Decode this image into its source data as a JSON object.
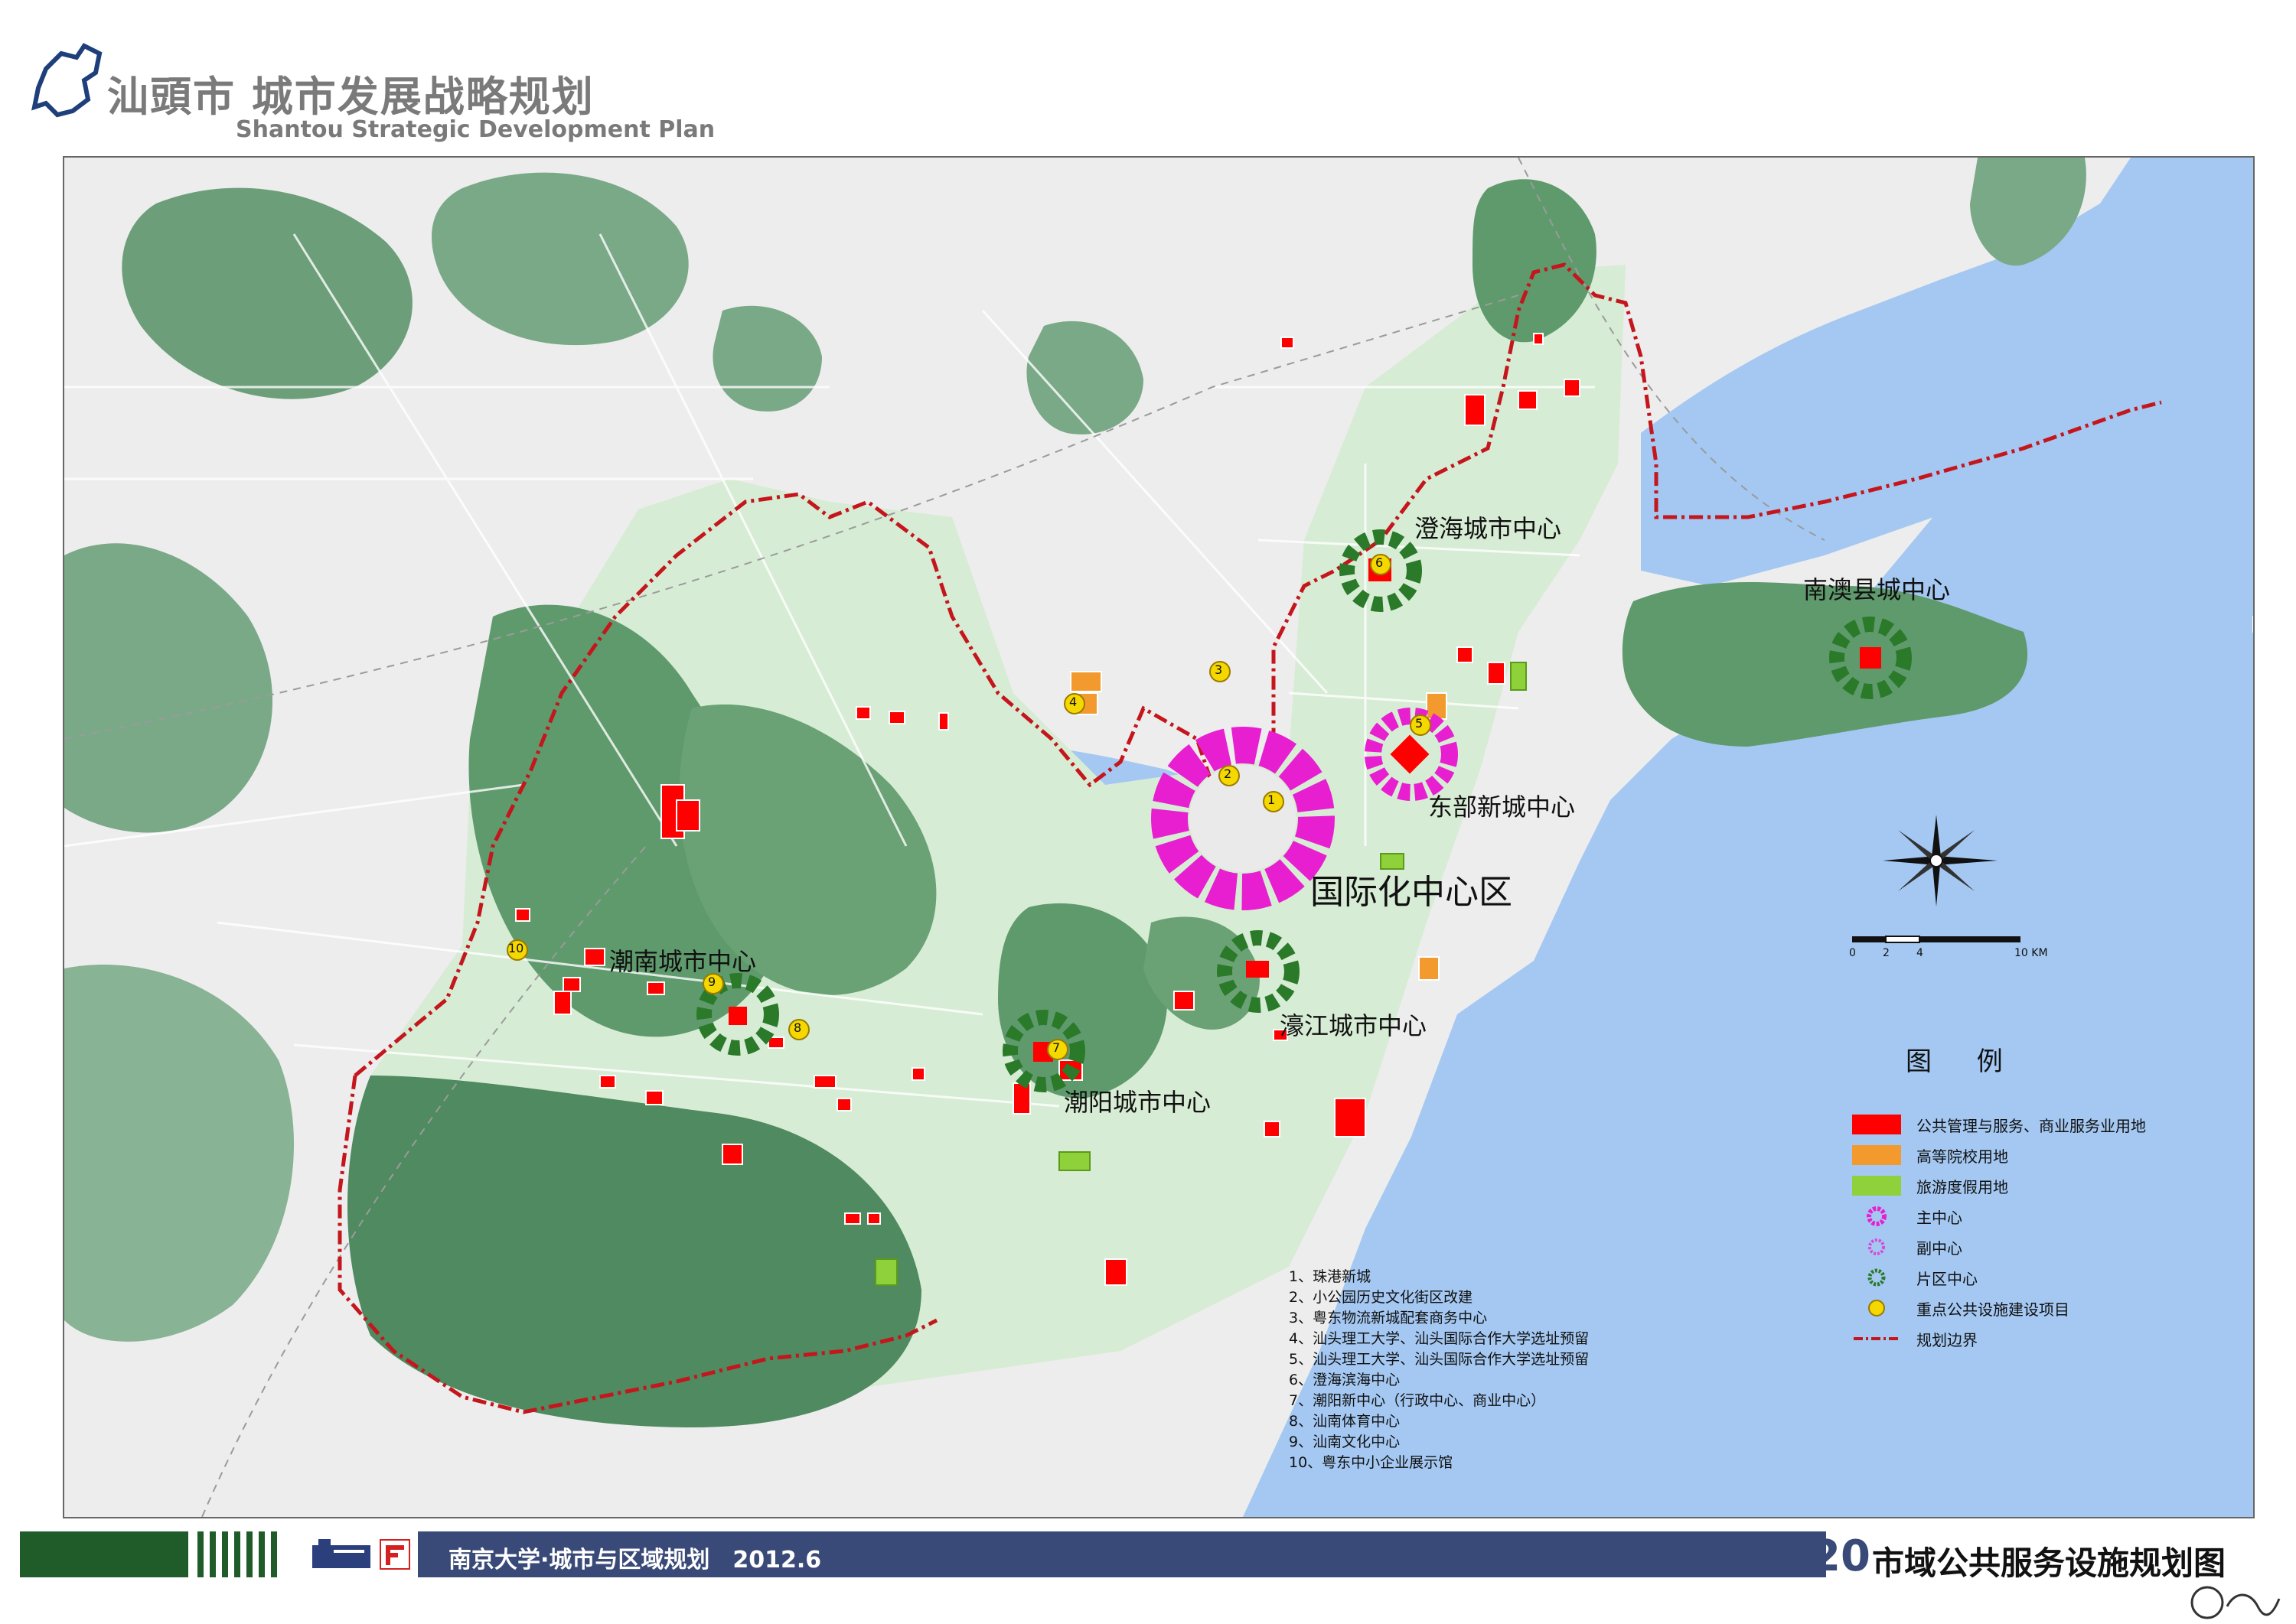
{
  "header": {
    "title_cn": "汕頭市 城市发展战略规划",
    "title_en": "Shantou Strategic Development Plan"
  },
  "map": {
    "center_labels": {
      "chenghai": "澄海城市中心",
      "nanao": "南澳县城中心",
      "dongbu": "东部新城中心",
      "intl": "国际化中心区",
      "haojiang": "濠江城市中心",
      "chaonan": "潮南城市中心",
      "chaoyang": "潮阳城市中心"
    },
    "markers": [
      "1",
      "2",
      "3",
      "4",
      "5",
      "6",
      "7",
      "8",
      "9",
      "10"
    ],
    "scale_ticks": [
      "0",
      "2",
      "4",
      "10 KM"
    ]
  },
  "legend": {
    "title": "图 例",
    "items": [
      {
        "label": "公共管理与服务、商业服务业用地",
        "color": "#ff0000"
      },
      {
        "label": "高等院校用地",
        "color": "#f39a2e"
      },
      {
        "label": "旅游度假用地",
        "color": "#8fd13a"
      },
      {
        "label": "主中心",
        "color": "#e81fd0"
      },
      {
        "label": "副中心",
        "color": "#d64ad6"
      },
      {
        "label": "片区中心",
        "color": "#2a7a2a"
      },
      {
        "label": "重点公共设施建设项目",
        "color": "#f5d800"
      },
      {
        "label": "规划边界",
        "color": "#c4161c"
      }
    ]
  },
  "projects": [
    "1、珠港新城",
    "2、小公园历史文化街区改建",
    "3、粤东物流新城配套商务中心",
    "4、汕头理工大学、汕头国际合作大学选址预留",
    "5、汕头理工大学、汕头国际合作大学选址预留",
    "6、澄海滨海中心",
    "7、潮阳新中心（行政中心、商业中心）",
    "8、汕南体育中心",
    "9、汕南文化中心",
    "10、粤东中小企业展示馆"
  ],
  "footer": {
    "org": "南京大学·城市与区域规划　2012.6",
    "number": "20",
    "doc_title": "市域公共服务设施规划图"
  }
}
